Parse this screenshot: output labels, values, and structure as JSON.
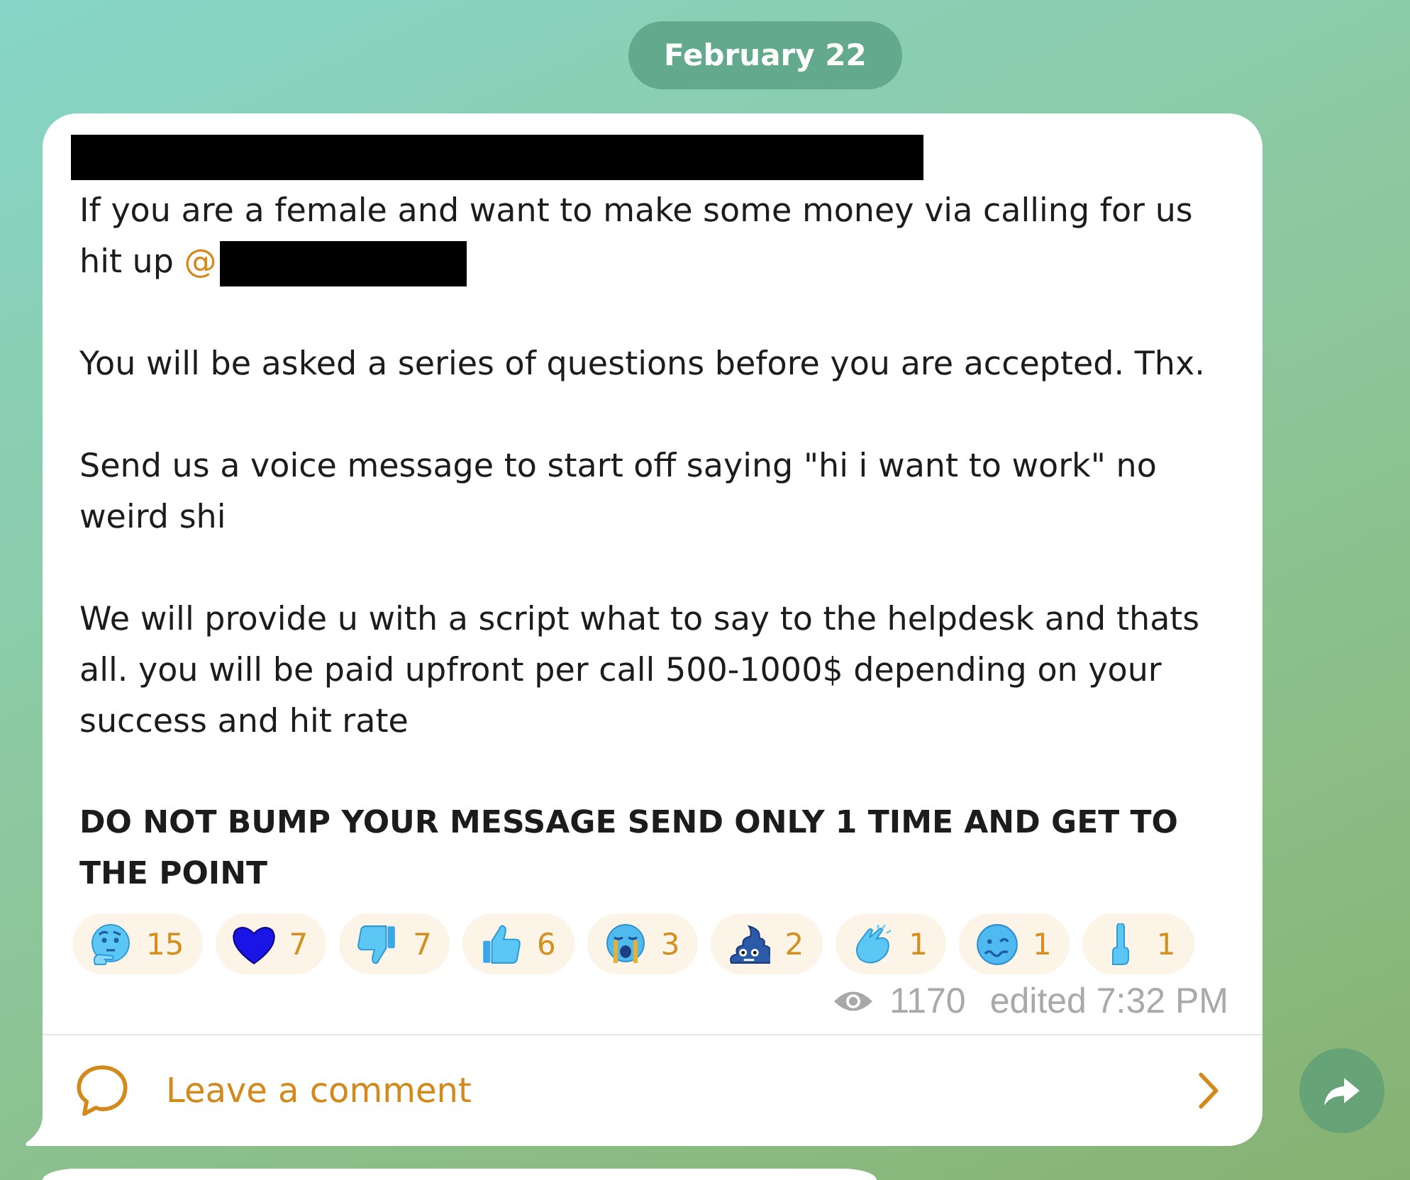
{
  "date_badge": {
    "label": "February 22"
  },
  "post": {
    "author": {
      "redacted": true
    },
    "paragraphs": [
      {
        "text": "If you are a female and want to make some money via calling for us hit up",
        "bold": false,
        "mention": {
          "text": "@",
          "redacted": true
        }
      },
      {
        "text": "You will be asked a series of questions before you are accepted. Thx.",
        "bold": false
      },
      {
        "text": "Send us a voice message to start off saying \"hi i want to work\" no weird shi",
        "bold": false
      },
      {
        "text": "We will provide u with a script what to say to the helpdesk and thats all. you will be paid upfront per call 500-1000$ depending on your success and hit rate",
        "bold": false
      },
      {
        "text": "DO NOT BUMP YOUR MESSAGE SEND ONLY 1 TIME AND GET TO THE POINT",
        "bold": true
      }
    ],
    "reactions": [
      {
        "kind": "thinking",
        "count": "15"
      },
      {
        "kind": "heart",
        "count": "7"
      },
      {
        "kind": "dislike",
        "count": "7"
      },
      {
        "kind": "like",
        "count": "6"
      },
      {
        "kind": "crying",
        "count": "3"
      },
      {
        "kind": "poop",
        "count": "2"
      },
      {
        "kind": "clap",
        "count": "1"
      },
      {
        "kind": "woozy",
        "count": "1"
      },
      {
        "kind": "finger",
        "count": "1"
      }
    ],
    "views": "1170",
    "time": "edited 7:32 PM",
    "comment_link": {
      "label": "Leave a comment"
    }
  }
}
